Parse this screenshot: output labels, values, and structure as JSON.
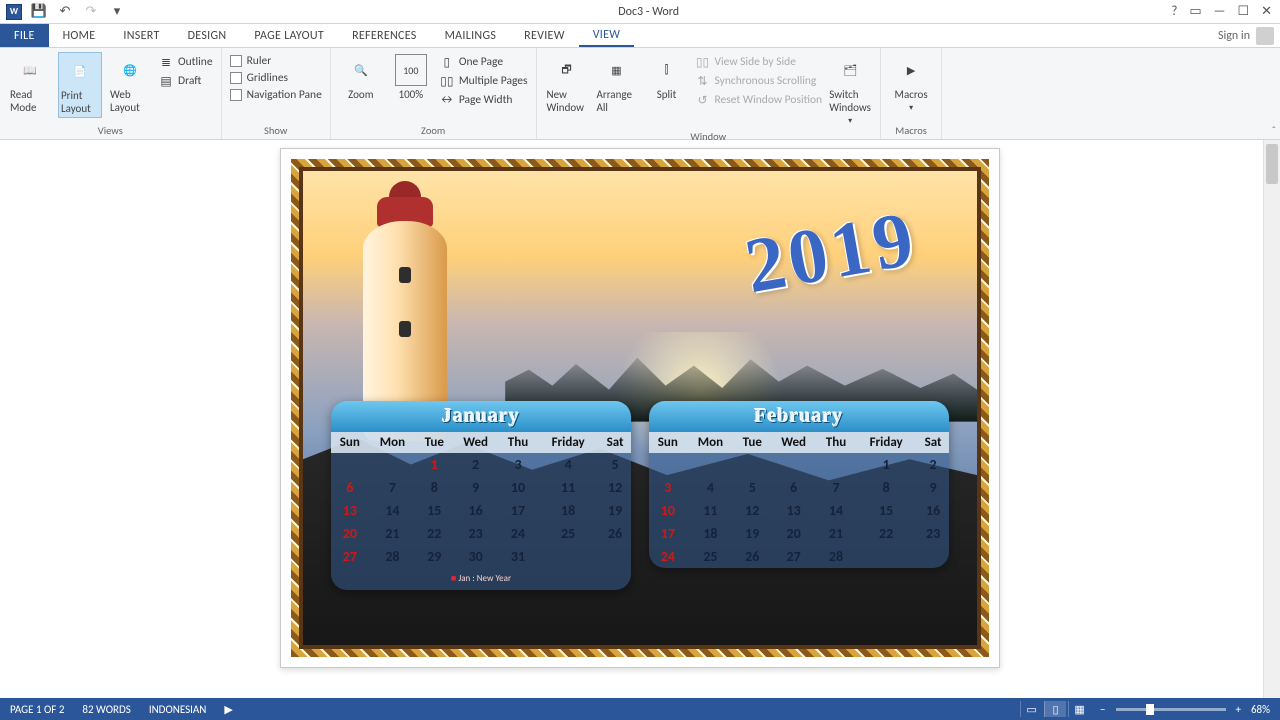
{
  "title": "Doc3 - Word",
  "signin": "Sign in",
  "tabs": {
    "file": "FILE",
    "home": "HOME",
    "insert": "INSERT",
    "design": "DESIGN",
    "page_layout": "PAGE LAYOUT",
    "references": "REFERENCES",
    "mailings": "MAILINGS",
    "review": "REVIEW",
    "view": "VIEW"
  },
  "ribbon": {
    "views": {
      "label": "Views",
      "read_mode": "Read Mode",
      "print_layout": "Print Layout",
      "web_layout": "Web Layout",
      "outline": "Outline",
      "draft": "Draft"
    },
    "show": {
      "label": "Show",
      "ruler": "Ruler",
      "gridlines": "Gridlines",
      "nav": "Navigation Pane"
    },
    "zoom": {
      "label": "Zoom",
      "zoom": "Zoom",
      "hundred": "100%",
      "one_page": "One Page",
      "multiple": "Multiple Pages",
      "page_width": "Page Width"
    },
    "window": {
      "label": "Window",
      "new_window": "New Window",
      "arrange_all": "Arrange All",
      "split": "Split",
      "side": "View Side by Side",
      "sync": "Synchronous Scrolling",
      "reset": "Reset Window Position",
      "switch": "Switch Windows"
    },
    "macros": {
      "label": "Macros",
      "macros": "Macros"
    }
  },
  "doc": {
    "year": "2019",
    "days": [
      "Sun",
      "Mon",
      "Tue",
      "Wed",
      "Thu",
      "Friday",
      "Sat"
    ],
    "jan": {
      "title": "January",
      "rows": [
        [
          "",
          "",
          "1",
          "2",
          "3",
          "4",
          "5"
        ],
        [
          "6",
          "7",
          "8",
          "9",
          "10",
          "11",
          "12"
        ],
        [
          "13",
          "14",
          "15",
          "16",
          "17",
          "18",
          "19"
        ],
        [
          "20",
          "21",
          "22",
          "23",
          "24",
          "25",
          "26"
        ],
        [
          "27",
          "28",
          "29",
          "30",
          "31",
          "",
          ""
        ]
      ],
      "note": "Jan : New Year"
    },
    "feb": {
      "title": "February",
      "rows": [
        [
          "",
          "",
          "",
          "",
          "",
          "1",
          "2"
        ],
        [
          "3",
          "4",
          "5",
          "6",
          "7",
          "8",
          "9"
        ],
        [
          "10",
          "11",
          "12",
          "13",
          "14",
          "15",
          "16"
        ],
        [
          "17",
          "18",
          "19",
          "20",
          "21",
          "22",
          "23"
        ],
        [
          "24",
          "25",
          "26",
          "27",
          "28",
          "",
          ""
        ]
      ]
    }
  },
  "status": {
    "page": "PAGE 1 OF 2",
    "words": "82 WORDS",
    "lang": "INDONESIAN",
    "zoom": "68%"
  }
}
